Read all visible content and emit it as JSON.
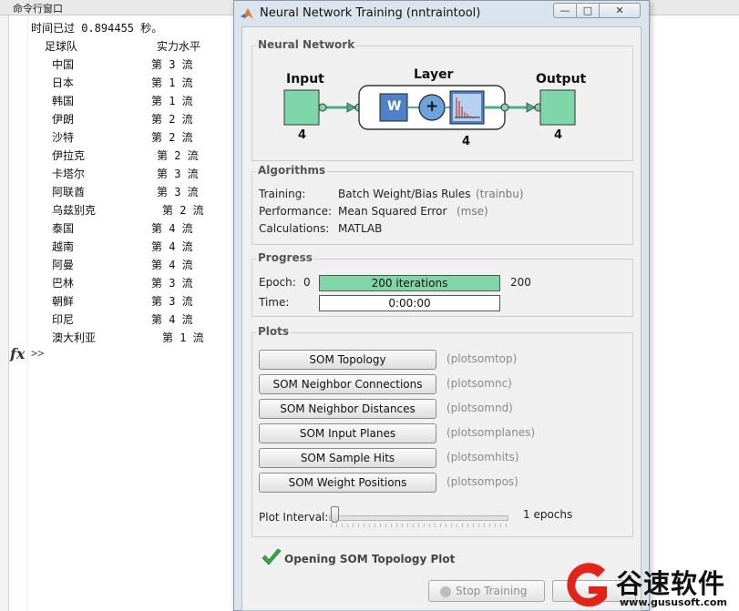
{
  "command_window": {
    "title": "命令行窗口",
    "elapsed_line": "时间已过 0.894455 秒。",
    "header": {
      "team": "足球队",
      "level": "实力水平"
    },
    "rows": [
      {
        "team": "中国",
        "level": "第 3 流"
      },
      {
        "team": "日本",
        "level": "第 1 流"
      },
      {
        "team": "韩国",
        "level": "第 1 流"
      },
      {
        "team": "伊朗",
        "level": "第 2 流"
      },
      {
        "team": "沙特",
        "level": "第 2 流"
      },
      {
        "team": "伊拉克",
        "level": "第 2 流"
      },
      {
        "team": "卡塔尔",
        "level": "第 3 流"
      },
      {
        "team": "阿联酋",
        "level": "第 3 流"
      },
      {
        "team": "乌兹别克",
        "level": "第 2 流"
      },
      {
        "team": "泰国",
        "level": "第 4 流"
      },
      {
        "team": "越南",
        "level": "第 4 流"
      },
      {
        "team": "阿曼",
        "level": "第 4 流"
      },
      {
        "team": "巴林",
        "level": "第 3 流"
      },
      {
        "team": "朝鲜",
        "level": "第 3 流"
      },
      {
        "team": "印尼",
        "level": "第 4 流"
      },
      {
        "team": "澳大利亚",
        "level": "第 1 流"
      }
    ],
    "fx_symbol": "fx",
    "prompt": ">>"
  },
  "window": {
    "title": "Neural Network Training (nntraintool)",
    "close_glyph": "✕",
    "minimize_glyph": "—",
    "maximize_glyph": "□"
  },
  "network": {
    "group_title": "Neural Network",
    "input_label": "Input",
    "input_size": "4",
    "layer_label": "Layer",
    "layer_size": "4",
    "weight_label": "W",
    "sum_label": "+",
    "output_label": "Output",
    "output_size": "4"
  },
  "algorithms": {
    "group_title": "Algorithms",
    "training_key": "Training:",
    "training_value": "Batch Weight/Bias Rules",
    "training_fn": "(trainbu)",
    "performance_key": "Performance:",
    "performance_value": "Mean Squared Error",
    "performance_fn": "(mse)",
    "calculations_key": "Calculations:",
    "calculations_value": "MATLAB"
  },
  "progress": {
    "group_title": "Progress",
    "epoch_label": "Epoch:",
    "epoch_min": "0",
    "epoch_text": "200 iterations",
    "epoch_max": "200",
    "epoch_fraction": 1.0,
    "time_label": "Time:",
    "time_text": "0:00:00"
  },
  "plots": {
    "group_title": "Plots",
    "buttons": [
      {
        "label": "SOM Topology",
        "fn": "(plotsomtop)"
      },
      {
        "label": "SOM Neighbor Connections",
        "fn": "(plotsomnc)"
      },
      {
        "label": "SOM Neighbor Distances",
        "fn": "(plotsomnd)"
      },
      {
        "label": "SOM Input Planes",
        "fn": "(plotsomplanes)"
      },
      {
        "label": "SOM Sample Hits",
        "fn": "(plotsomhits)"
      },
      {
        "label": "SOM Weight Positions",
        "fn": "(plotsompos)"
      }
    ],
    "interval_label": "Plot Interval:",
    "interval_value": "1 epochs"
  },
  "status": {
    "message": "Opening SOM Topology Plot"
  },
  "buttons": {
    "stop_training": "Stop Training"
  },
  "watermark": {
    "text": "谷速软件",
    "url": "www.gususoft.com"
  },
  "colors": {
    "accent_green": "#7fd6a9",
    "layer_blue": "#4f81c7",
    "check_green": "#3aa64a",
    "watermark_red": "#e2231a"
  }
}
